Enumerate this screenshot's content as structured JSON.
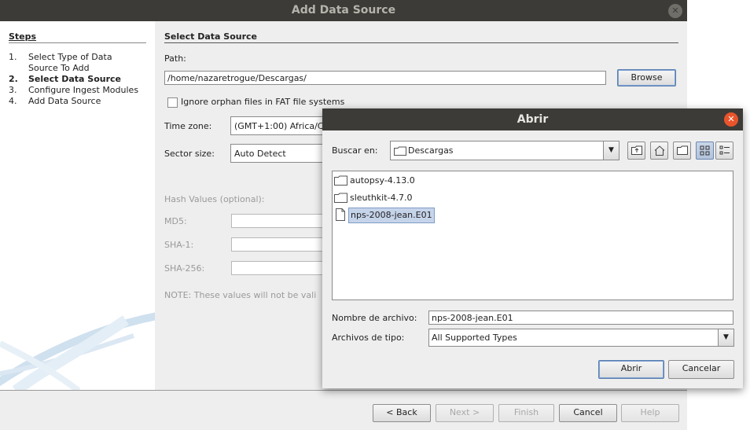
{
  "wizard": {
    "title": "Add Data Source",
    "steps_heading": "Steps",
    "steps": [
      {
        "num": "1.",
        "label": "Select Type of Data Source To Add"
      },
      {
        "num": "2.",
        "label": "Select Data Source"
      },
      {
        "num": "3.",
        "label": "Configure Ingest Modules"
      },
      {
        "num": "4.",
        "label": "Add Data Source"
      }
    ],
    "section_title": "Select Data Source",
    "path_label": "Path:",
    "path_value": "/home/nazaretrogue/Descargas/",
    "browse_label": "Browse",
    "ignore_orphan_label": "Ignore orphan files in FAT file systems",
    "timezone_label": "Time zone:",
    "timezone_value": "(GMT+1:00) Africa/C",
    "sector_label": "Sector size:",
    "sector_value": "Auto Detect",
    "hash_title": "Hash Values (optional):",
    "md5_label": "MD5:",
    "sha1_label": "SHA-1:",
    "sha256_label": "SHA-256:",
    "note": "NOTE: These values will not be vali",
    "buttons": {
      "back": "< Back",
      "next": "Next >",
      "finish": "Finish",
      "cancel": "Cancel",
      "help": "Help"
    }
  },
  "dialog": {
    "title": "Abrir",
    "lookin_label": "Buscar en:",
    "lookin_value": "Descargas",
    "toolbar_icons": [
      "up-folder-icon",
      "home-icon",
      "new-folder-icon",
      "list-view-icon",
      "details-view-icon"
    ],
    "files": [
      {
        "name": "autopsy-4.13.0",
        "type": "folder"
      },
      {
        "name": "sleuthkit-4.7.0",
        "type": "folder"
      },
      {
        "name": "nps-2008-jean.E01",
        "type": "file",
        "selected": true
      }
    ],
    "filename_label": "Nombre de archivo:",
    "filename_value": "nps-2008-jean.E01",
    "filetype_label": "Archivos de tipo:",
    "filetype_value": "All Supported Types",
    "open_label": "Abrir",
    "cancel_label": "Cancelar"
  }
}
